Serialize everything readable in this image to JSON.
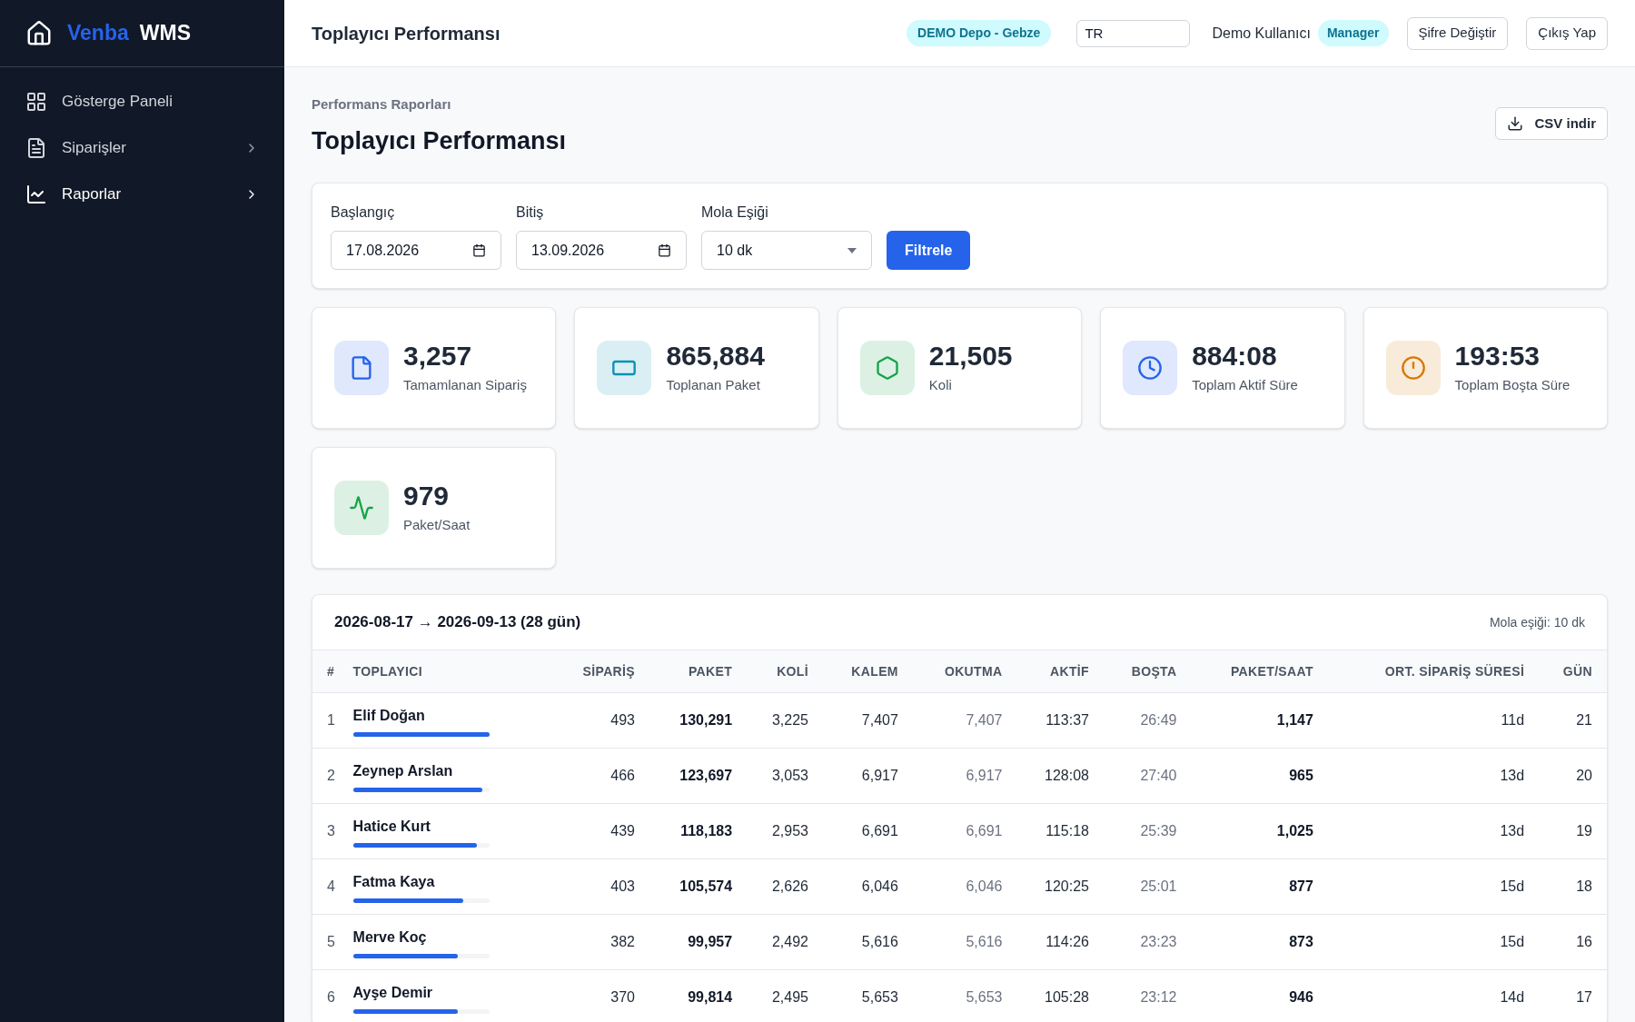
{
  "brand": {
    "first": "Venba",
    "second": "WMS"
  },
  "sidebar": {
    "items": [
      {
        "label": "Gösterge Paneli",
        "selected": false,
        "expandable": false
      },
      {
        "label": "Siparişler",
        "selected": false,
        "expandable": true
      },
      {
        "label": "Raporlar",
        "selected": true,
        "expandable": true
      }
    ]
  },
  "header": {
    "title": "Toplayıcı Performansı",
    "warehouse_badge": "DEMO Depo - Gebze",
    "language_value": "TR",
    "user": "Demo Kullanıcı",
    "role_badge": "Manager",
    "buttons": [
      "Şifre Değiştir",
      "Çıkış Yap"
    ]
  },
  "page": {
    "breadcrumb": "Performans Raporları",
    "title": "Toplayıcı Performansı",
    "export_button": "CSV indir"
  },
  "filters": {
    "fields": [
      {
        "kind": "date",
        "label": "Başlangıç",
        "value": "17.08.2026"
      },
      {
        "kind": "date",
        "label": "Bitiş",
        "value": "13.09.2026"
      },
      {
        "kind": "select",
        "label": "Mola Eşiği",
        "value": "10 dk"
      }
    ],
    "button": "Filtrele"
  },
  "stats": [
    {
      "value": "3,257",
      "label": "Tamamlanan Sipariş",
      "color": "#2563eb"
    },
    {
      "value": "865,884",
      "label": "Toplanan Paket",
      "color": "#0891b2"
    },
    {
      "value": "21,505",
      "label": "Koli",
      "color": "#16a34a"
    },
    {
      "value": "884:08",
      "label": "Toplam Aktif Süre",
      "color": "#2563eb"
    },
    {
      "value": "193:53",
      "label": "Toplam Boşta Süre",
      "color": "#d97706"
    },
    {
      "value": "979",
      "label": "Paket/Saat",
      "color": "#16a34a"
    }
  ],
  "table": {
    "range": "2026-08-17 → 2026-09-13 (28 gün)",
    "threshold_note": "Mola eşiği: 10 dk",
    "columns": [
      "#",
      "TOPLAYICI",
      "SİPARİŞ",
      "PAKET",
      "KOLİ",
      "KALEM",
      "OKUTMA",
      "AKTİF",
      "BOŞTA",
      "PAKET/SAAT",
      "ORT. SİPARİŞ SÜRESİ",
      "GÜN"
    ],
    "rows": [
      {
        "level": 1.0,
        "cells": [
          "1",
          "Elif Doğan",
          "493",
          "130,291",
          "3,225",
          "7,407",
          "7,407",
          "113:37",
          "26:49",
          "1,147",
          "11d",
          "21"
        ]
      },
      {
        "level": 0.95,
        "cells": [
          "2",
          "Zeynep Arslan",
          "466",
          "123,697",
          "3,053",
          "6,917",
          "6,917",
          "128:08",
          "27:40",
          "965",
          "13d",
          "20"
        ]
      },
      {
        "level": 0.91,
        "cells": [
          "3",
          "Hatice Kurt",
          "439",
          "118,183",
          "2,953",
          "6,691",
          "6,691",
          "115:18",
          "25:39",
          "1,025",
          "13d",
          "19"
        ]
      },
      {
        "level": 0.81,
        "cells": [
          "4",
          "Fatma Kaya",
          "403",
          "105,574",
          "2,626",
          "6,046",
          "6,046",
          "120:25",
          "25:01",
          "877",
          "15d",
          "18"
        ]
      },
      {
        "level": 0.77,
        "cells": [
          "5",
          "Merve Koç",
          "382",
          "99,957",
          "2,492",
          "5,616",
          "5,616",
          "114:26",
          "23:23",
          "873",
          "15d",
          "16"
        ]
      },
      {
        "level": 0.77,
        "cells": [
          "6",
          "Ayşe Demir",
          "370",
          "99,814",
          "2,495",
          "5,653",
          "5,653",
          "105:28",
          "23:12",
          "946",
          "14d",
          "17"
        ]
      }
    ]
  }
}
